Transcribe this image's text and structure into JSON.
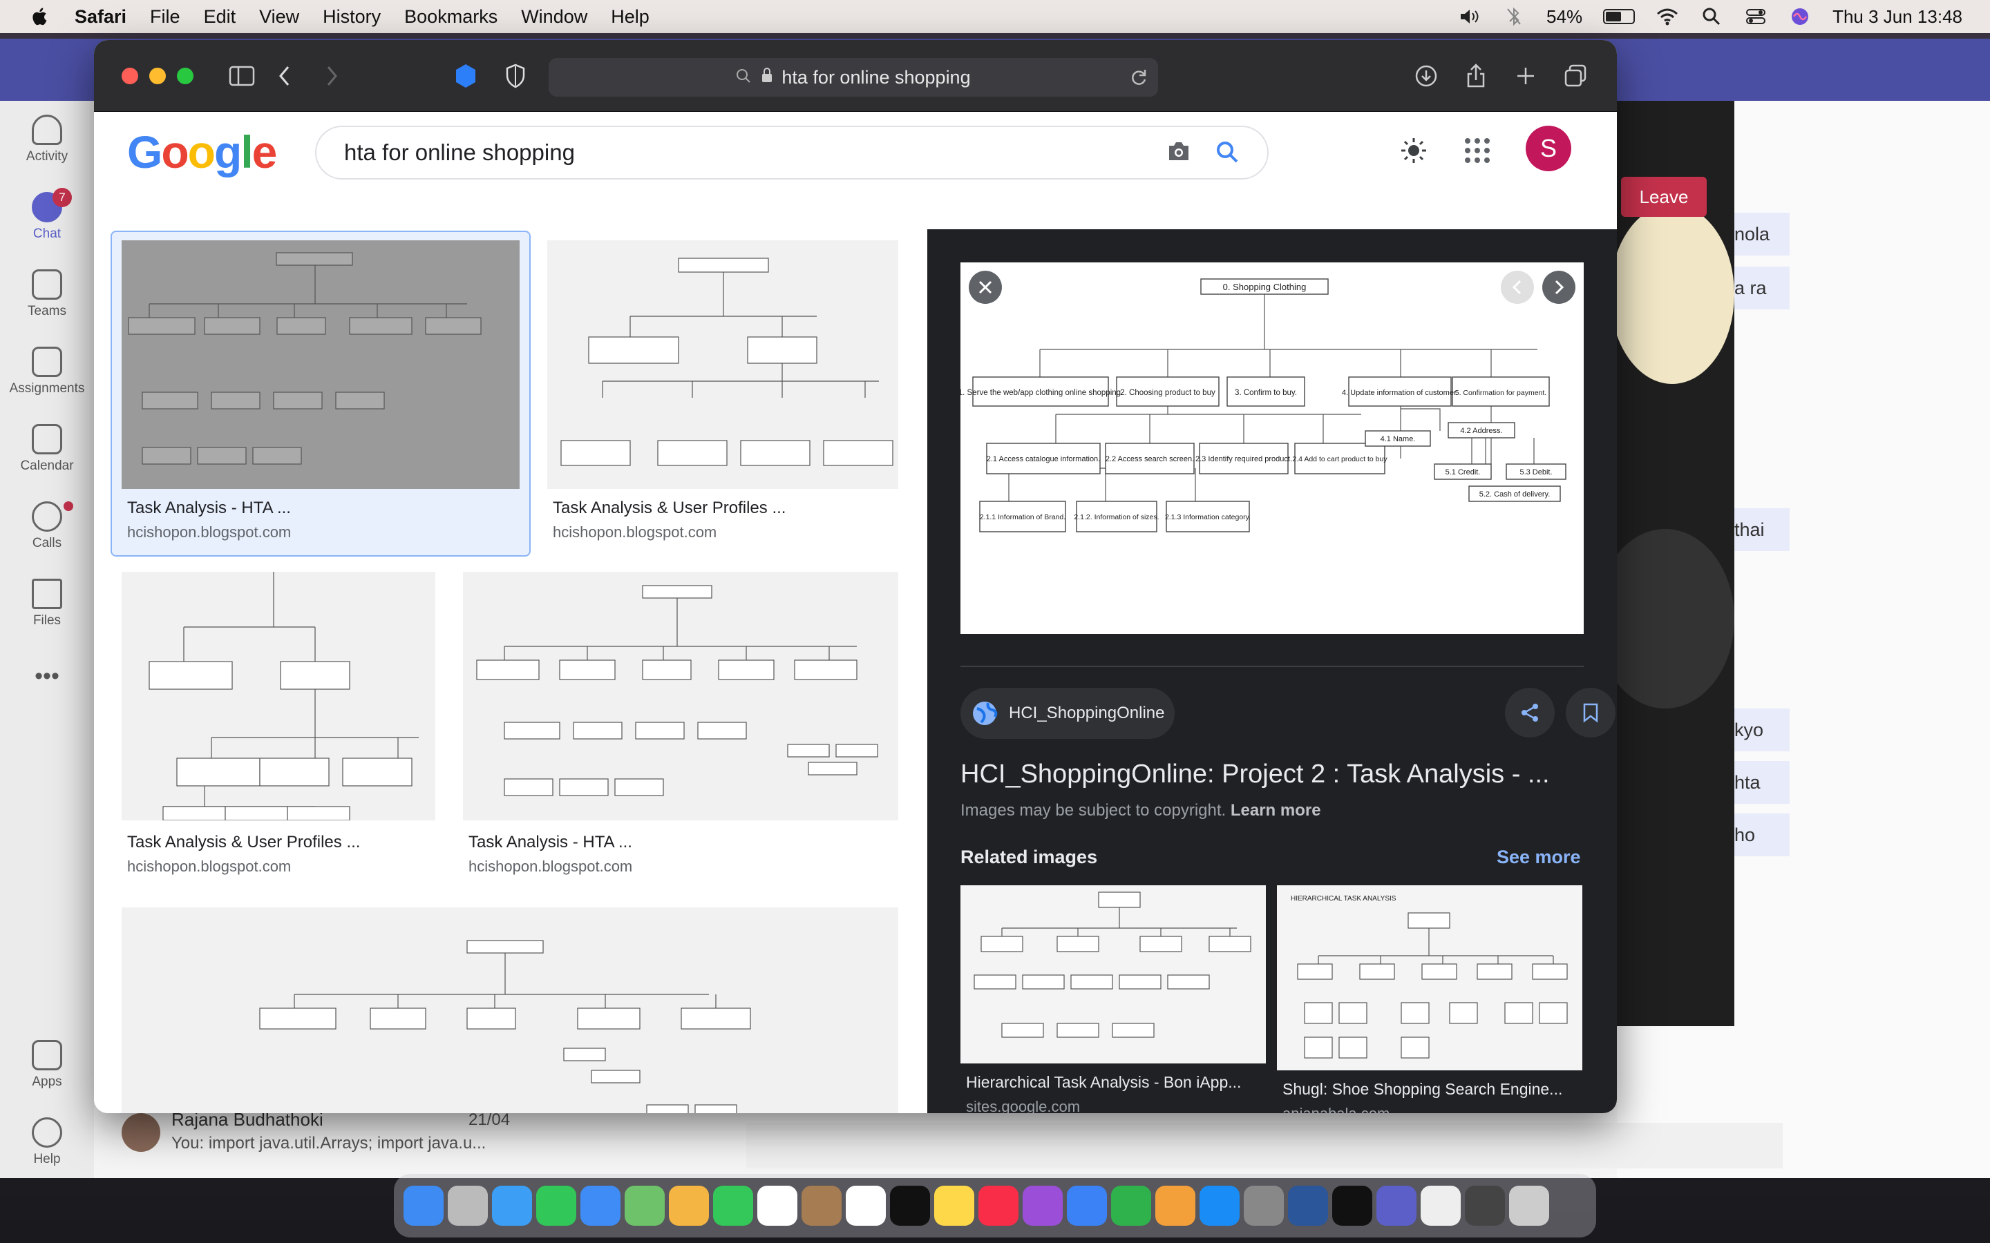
{
  "menubar": {
    "app_name": "Safari",
    "items": [
      "File",
      "Edit",
      "View",
      "History",
      "Bookmarks",
      "Window",
      "Help"
    ],
    "battery": "54%",
    "battery_level": 0.54,
    "datetime": "Thu 3 Jun  13:48"
  },
  "teams": {
    "rail": [
      {
        "label": "Activity"
      },
      {
        "label": "Chat",
        "badge": "7"
      },
      {
        "label": "Teams"
      },
      {
        "label": "Assignments"
      },
      {
        "label": "Calendar"
      },
      {
        "label": "Calls"
      },
      {
        "label": "Files"
      },
      {
        "label": "Apps"
      },
      {
        "label": "Help"
      }
    ],
    "leave_label": "Leave",
    "chat_snippets": [
      "nola",
      "a ra",
      "thai",
      "kyo",
      "hta",
      "ho"
    ],
    "conversation": {
      "name": "Rajana Budhathoki",
      "date": "21/04",
      "preview": "You: import java.util.Arrays; import java.u..."
    }
  },
  "safari": {
    "address": "hta for online shopping"
  },
  "google": {
    "logo": "Google",
    "query": "hta for online shopping",
    "avatar_letter": "S",
    "results": [
      {
        "title": "Task Analysis - HTA ...",
        "source": "hcishopon.blogspot.com"
      },
      {
        "title": "Task Analysis & User Profiles ...",
        "source": "hcishopon.blogspot.com"
      },
      {
        "title": "Task Analysis & User Profiles ...",
        "source": "hcishopon.blogspot.com"
      },
      {
        "title": "Task Analysis - HTA ...",
        "source": "hcishopon.blogspot.com"
      }
    ],
    "panel": {
      "site_name": "HCI_ShoppingOnline",
      "title": "HCI_ShoppingOnline: Project 2 : Task Analysis - ...",
      "copyright": "Images may be subject to copyright.",
      "learn_more": "Learn more",
      "related_heading": "Related images",
      "see_more": "See more",
      "related": [
        {
          "title": "Hierarchical Task Analysis - Bon iApp...",
          "source": "sites.google.com"
        },
        {
          "title": "Shugl: Shoe Shopping Search Engine...",
          "source": "anjanabala.com"
        }
      ]
    },
    "diagram": {
      "root": "0.   Shopping Clothing",
      "level1": [
        "1. Serve the web/app clothing online shopping.",
        "2. Choosing product to buy",
        "3. Confirm to buy.",
        "4. Update information of customer.",
        "5. Confirmation for payment."
      ],
      "level2": [
        "2.1 Access catalogue information.",
        "2.2 Access search screen.",
        "2.3 Identify required product.",
        "2.4 Add to cart product to buy"
      ],
      "level3": [
        "2.1.1 Information of Brand.",
        "2.1.2. Information of sizes.",
        "2.1.3 Information category."
      ],
      "sub4": [
        "4.1 Name.",
        "4.2 Address."
      ],
      "sub5": [
        "5.1 Credit.",
        "5.3 Debit.",
        "5.2. Cash of delivery."
      ]
    }
  }
}
